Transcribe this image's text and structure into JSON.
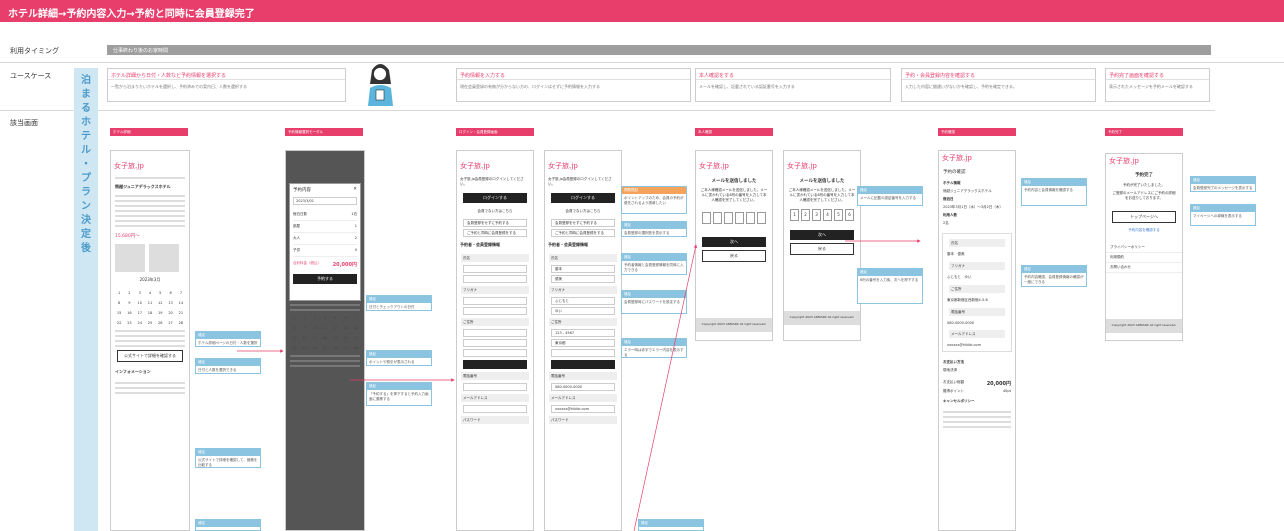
{
  "title": "ホテル詳細→予約内容入力→予約と同時に会員登録完了",
  "rows": {
    "timing": "利用タイミング",
    "usecase": "ユースケース",
    "screen": "該当画面"
  },
  "timing_bar": "仕事終わり後のお家時間",
  "vertical_label": [
    "泊",
    "ま",
    "る",
    "ホ",
    "テ",
    "ル",
    "・",
    "プ",
    "ラ",
    "ン",
    "決",
    "定",
    "後"
  ],
  "usecases": [
    {
      "title": "ホテル詳細から日付・人数など予約情報を選択する",
      "desc": "一覧から泊まりたいホテルを選択し、予約済みでの案内日、人数を選択する"
    },
    {
      "title": "予約情報を入力する",
      "desc": "現在会員登録の有無が分からない方の、ログインはせずに予約情報を入力する"
    },
    {
      "title": "本人確認をする",
      "desc": "メールを確認し、記載されている認証番号を入力する"
    },
    {
      "title": "予約・会員登録内容を確認する",
      "desc": "入力した内容に間違いがないかを確認し、予約を確定できる。"
    },
    {
      "title": "予約完了画面を確認する",
      "desc": "表示されたメッセージを予約メールを確認する"
    }
  ],
  "screen_labels": [
    "ホテル詳細",
    "予約情報選択モーダル",
    "ログイン・会員登録画面",
    "本人確認",
    "予約確認",
    "予約完了"
  ],
  "logo": "女子旅.jp",
  "detail": {
    "hotel_name": "熊越ジュニアデラックスホテル",
    "price": "15,680円〜",
    "calendar_title": "2023年3月",
    "info_title": "インフォメーション",
    "external_btn": "公式サイトで詳細を確認する"
  },
  "modal": {
    "title": "予約内容",
    "date": "2023/3/01",
    "labels": [
      "宿泊日数",
      "部屋",
      "大人",
      "子供"
    ],
    "values": [
      "1泊",
      "1",
      "2",
      "0"
    ],
    "total_label": "合計料金（税込）",
    "total": "20,000円",
    "button": "予約する"
  },
  "login": {
    "intro": "女子旅.jp会員登録のログインしてください。",
    "login_btn": "ログインする",
    "guest_title": "会員でない方はこちら",
    "opt1": "会員登録をせずに予約する",
    "opt2": "ご予約と同時に会員登録をする",
    "form_title": "予約者・会員登録情報",
    "fields": [
      "氏名",
      "フリガナ",
      "ご住所",
      "電話番号",
      "メールアドレス",
      "パスワード"
    ],
    "name_values": [
      "藤本",
      "優美"
    ],
    "kana_values": [
      "ふじもと",
      "ゆい"
    ],
    "zip": "123 - 4567",
    "zip_btn": "住所を検索する",
    "pref": "東京都",
    "phone": "080-0000-0000",
    "email": "xxxxxx@hikkb.com"
  },
  "verify": {
    "title": "メールを送信しました",
    "desc": "ご本人様確認メールを送信しました。メールに書かれている6桁の番号を入力して本人確認を完了してください。",
    "next": "次へ",
    "back": "戻る",
    "digits": [
      "1",
      "2",
      "3",
      "4",
      "5",
      "6"
    ],
    "footer": "Copyright 2023 ARMARK All right reserved."
  },
  "confirm": {
    "title": "予約の確認",
    "hotel_label": "ホテル情報",
    "hotel_name": "熊越ジュニアデラックスホテル",
    "date_label": "宿泊日",
    "date_value": "2023年3月1日（水）～3月2日（木）",
    "guests_label": "利用人数",
    "guests_value": "2名",
    "name_label": "氏名",
    "name_value": "藤本　優美",
    "kana_label": "フリガナ",
    "kana_value": "ふじもと　ゆい",
    "addr_label": "ご住所",
    "addr_value": "東京都新宿区西新宿4-5-6",
    "phone_label": "電話番号",
    "phone_value": "080-0000-0000",
    "email_label": "メールアドレス",
    "email_value": "xxxxxx@hikkb.com",
    "pay_label": "お支払い方法",
    "pay_value": "現地決済",
    "total_label": "お支払い総額",
    "total": "20,000円",
    "points_label": "獲得ポイント",
    "points": "40pt",
    "policy": "キャンセルポリシー"
  },
  "complete": {
    "title": "予約完了",
    "msg": "予約が完了いたしました。",
    "msg2": "ご登録のメールアドレスにご予約の詳細をお送りしております。",
    "btn": "トップページへ",
    "link": "予約内容を確認する",
    "links": [
      "プライバシーポリシー",
      "利用規約",
      "お問い合わせ"
    ],
    "footer": "Copyright 2023 ARMARK All right reserved."
  },
  "notes": [
    {
      "h": "補足",
      "b": "ホテル詳細ページの日付・人数を選択し予約を開始する"
    },
    {
      "h": "補足",
      "b": "日付と人数を選択できる"
    },
    {
      "h": "補足",
      "b": "公式サイトで詳細を確認して、価格を比較する"
    },
    {
      "h": "補足",
      "b": "日付とチェックアウトの日付"
    },
    {
      "h": "補足",
      "b": "ポイントや割引が表示される"
    },
    {
      "h": "補足",
      "b": "「予約する」を押下すると予約入力画面に遷移する"
    },
    {
      "h": "問題提起",
      "b": "ポイントアップのため、会員の予約が優先されるよう誘導したい"
    },
    {
      "h": "補足",
      "b": "会員登録の選択肢を表示する"
    },
    {
      "h": "補足",
      "b": "予約者情報と会員登録情報を同時に入力できる"
    },
    {
      "h": "補足",
      "b": "会員登録時にパスワードを設定する"
    },
    {
      "h": "補足",
      "b": "エラー時は赤字でエラー内容を表示する"
    },
    {
      "h": "補足",
      "b": "メールに記載の認証番号を入力する"
    },
    {
      "h": "補足",
      "b": "6桁の番号を入力後、次へを押下する"
    },
    {
      "h": "補足",
      "b": "予約内容と会員情報を確認する"
    },
    {
      "h": "補足",
      "b": "予約内容確認、会員登録情報の確認が一度にできる"
    },
    {
      "h": "補足",
      "b": "会員登録完了のメッセージを表示する"
    },
    {
      "h": "補足",
      "b": "マイページへの導線を表示する"
    }
  ]
}
